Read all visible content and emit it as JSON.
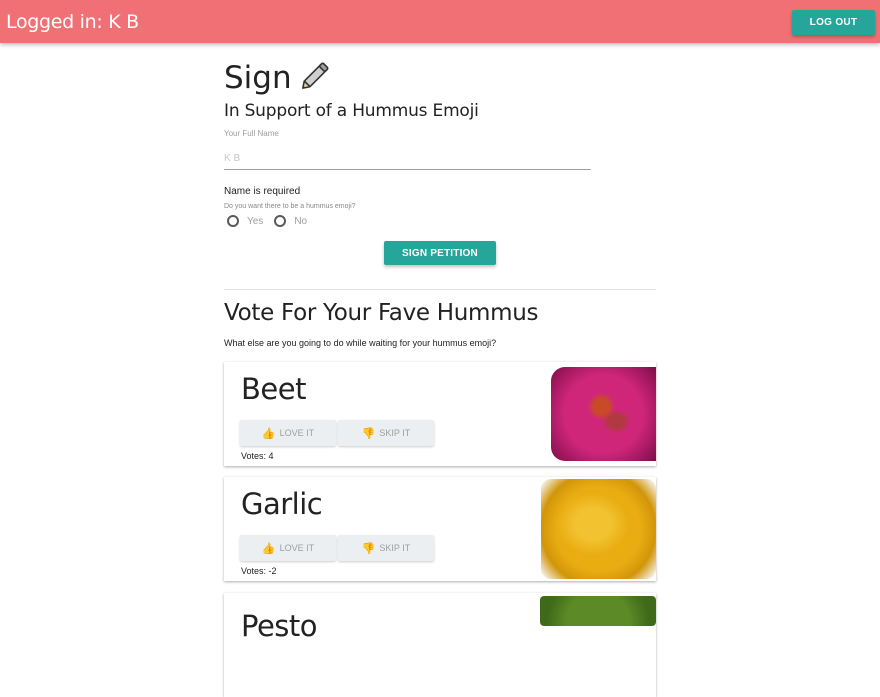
{
  "header": {
    "logged_in_text": "Logged in: K B",
    "logout_label": "LOG OUT"
  },
  "sign": {
    "title": "Sign",
    "subtitle": "In Support of a Hummus Emoji",
    "name_label": "Your Full Name",
    "name_value": "",
    "name_placeholder": "K B",
    "error": "Name is required",
    "question": "Do you want there to be a hummus emoji?",
    "options": [
      "Yes",
      "No"
    ],
    "submit_label": "SIGN PETITION"
  },
  "vote": {
    "title": "Vote For Your Fave Hummus",
    "description": "What else are you going to do while waiting for your hummus emoji?",
    "love_label": "LOVE IT",
    "skip_label": "SKIP IT",
    "cards": [
      {
        "name": "Beet",
        "votes": "Votes: 4"
      },
      {
        "name": "Garlic",
        "votes": "Votes: -2"
      },
      {
        "name": "Pesto",
        "votes": ""
      }
    ]
  },
  "colors": {
    "header_bg": "#f07075",
    "primary_button": "#26a69a",
    "vote_button_bg": "#eceff1"
  },
  "icons": {
    "sign_title": "pencil-icon",
    "love": "thumbs-up-icon",
    "skip": "thumbs-down-icon"
  }
}
